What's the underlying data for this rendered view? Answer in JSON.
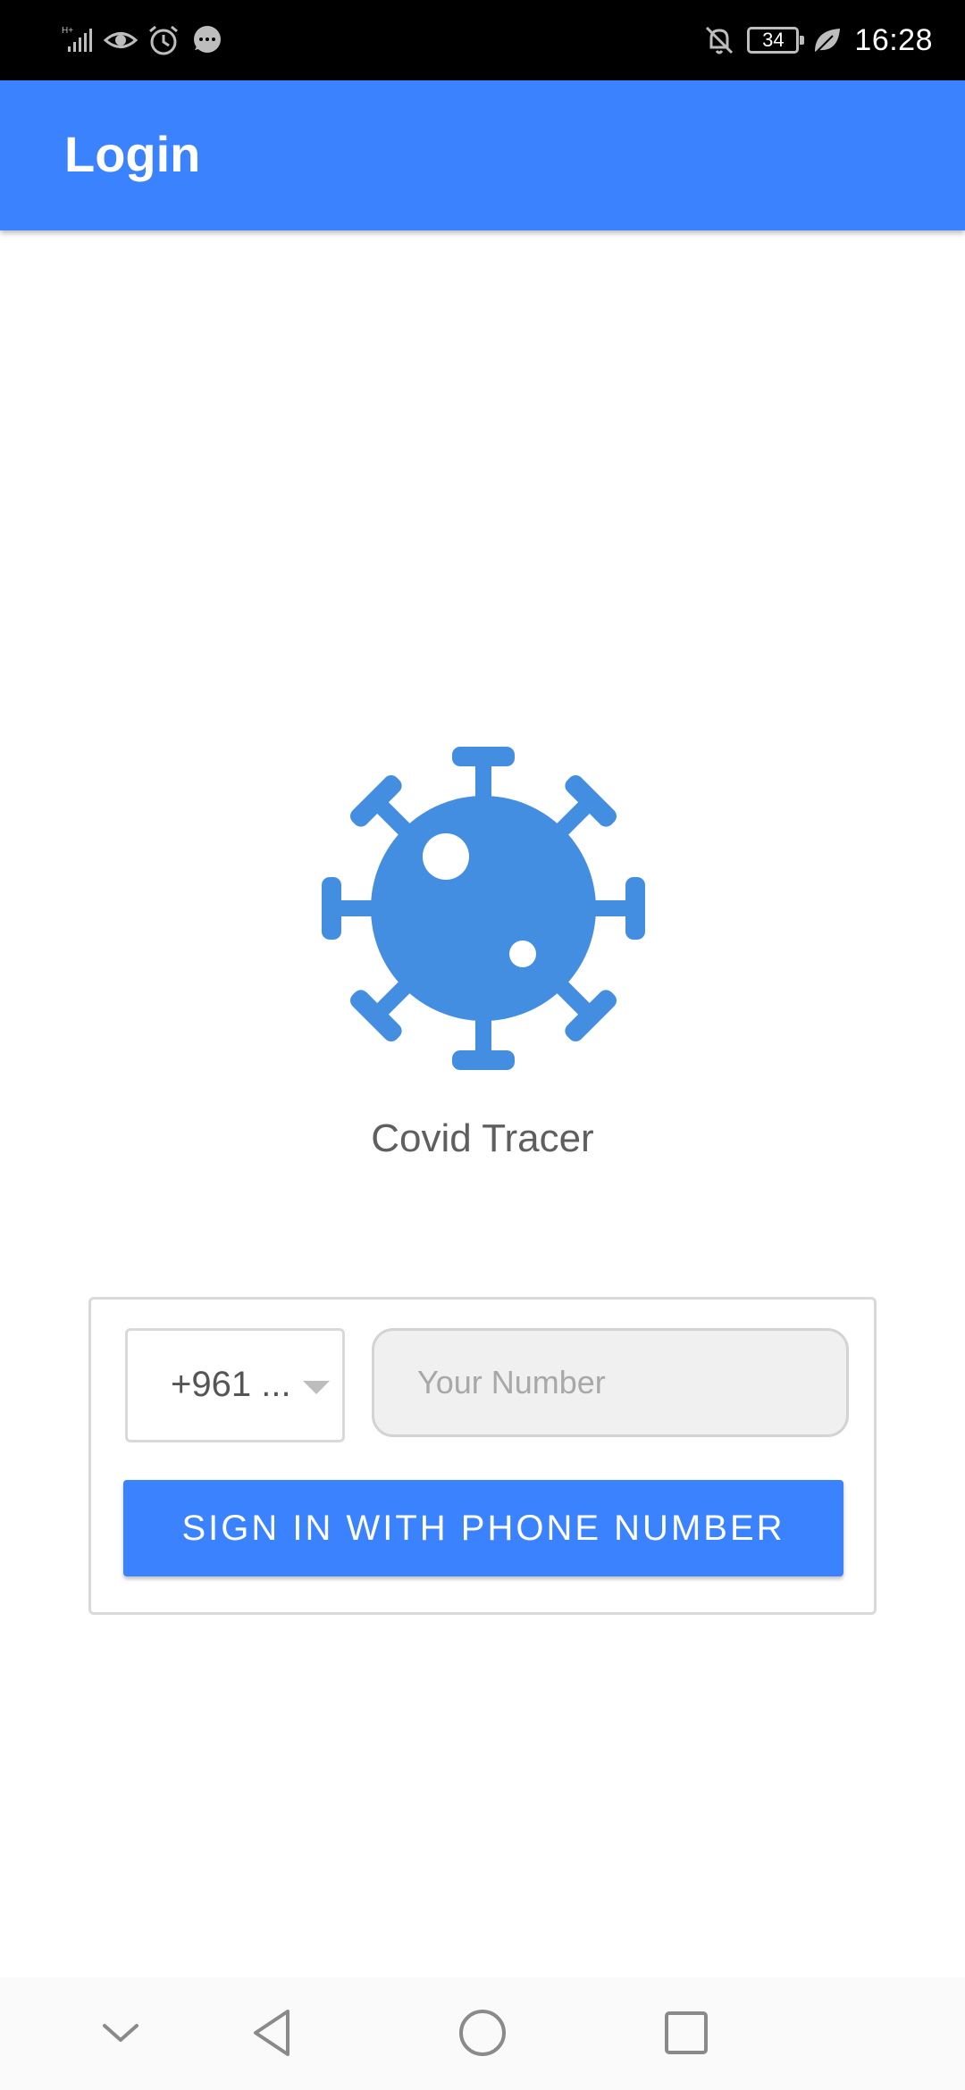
{
  "status_bar": {
    "time": "16:28",
    "battery": "34",
    "colors": {
      "background": "#000000",
      "icons": "#bdbdbd"
    },
    "left_icons": [
      "signal-icon",
      "eye-icon",
      "alarm-icon",
      "message-icon"
    ],
    "right_icons": [
      "notifications-off-icon",
      "battery-icon",
      "leaf-icon"
    ]
  },
  "app_bar": {
    "title": "Login",
    "color": "#3b82ff"
  },
  "logo": {
    "icon": "virus-icon",
    "color": "#448ee2"
  },
  "app_name": "Covid Tracer",
  "login_form": {
    "country_code": "+961 ...",
    "phone_placeholder": "Your Number",
    "phone_value": "",
    "signin_label": "SIGN IN WITH PHONE NUMBER",
    "button_color": "#3b82ff"
  },
  "nav_bar": {
    "buttons": [
      "chevron-down-icon",
      "back-icon",
      "home-icon",
      "recents-icon"
    ]
  }
}
